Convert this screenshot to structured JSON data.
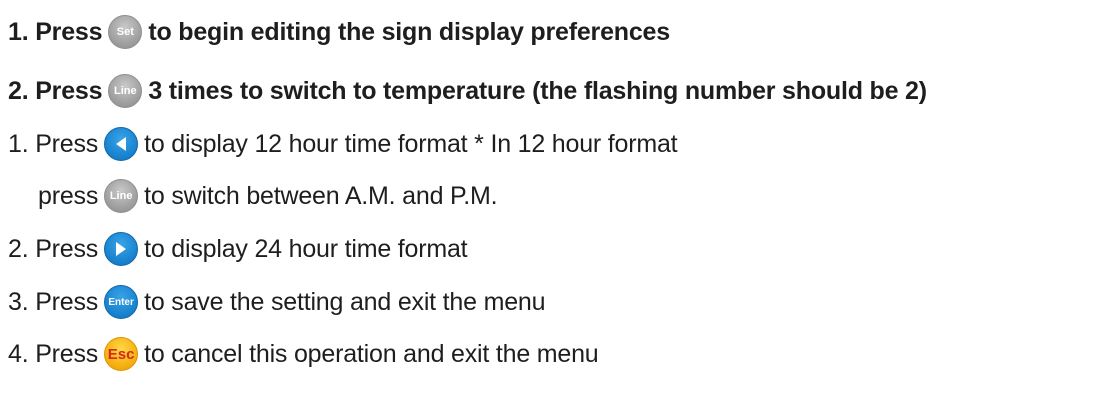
{
  "lines": [
    {
      "prefix": "1. Press",
      "button": {
        "label": "Set",
        "icon": "set-button-icon",
        "color": "#a4a4a4"
      },
      "suffix": "to begin editing the sign display preferences"
    },
    {
      "prefix": "2. Press",
      "button": {
        "label": "Line",
        "icon": "line-button-icon",
        "color": "#a4a4a4"
      },
      "suffix": "3 times to switch to temperature (the flashing number should be 2)"
    },
    {
      "prefix": "1. Press",
      "button": {
        "label": "",
        "icon": "left-arrow-button-icon",
        "color": "#1a86d2"
      },
      "suffix": "to display 12 hour time format * In 12 hour format"
    },
    {
      "prefix": "press",
      "button": {
        "label": "Line",
        "icon": "line-button-icon",
        "color": "#a4a4a4"
      },
      "suffix": "to switch between A.M. and P.M."
    },
    {
      "prefix": "2. Press",
      "button": {
        "label": "",
        "icon": "right-arrow-button-icon",
        "color": "#1a86d2"
      },
      "suffix": "to display 24 hour time format"
    },
    {
      "prefix": "3. Press",
      "button": {
        "label": "Enter",
        "icon": "enter-button-icon",
        "color": "#1a86d2"
      },
      "suffix": "to save the setting and exit the menu"
    },
    {
      "prefix": "4. Press",
      "button": {
        "label": "Esc",
        "icon": "esc-button-icon",
        "color": "#f6b312",
        "text_color": "#d8271b"
      },
      "suffix": "to cancel this operation and exit the menu"
    }
  ]
}
